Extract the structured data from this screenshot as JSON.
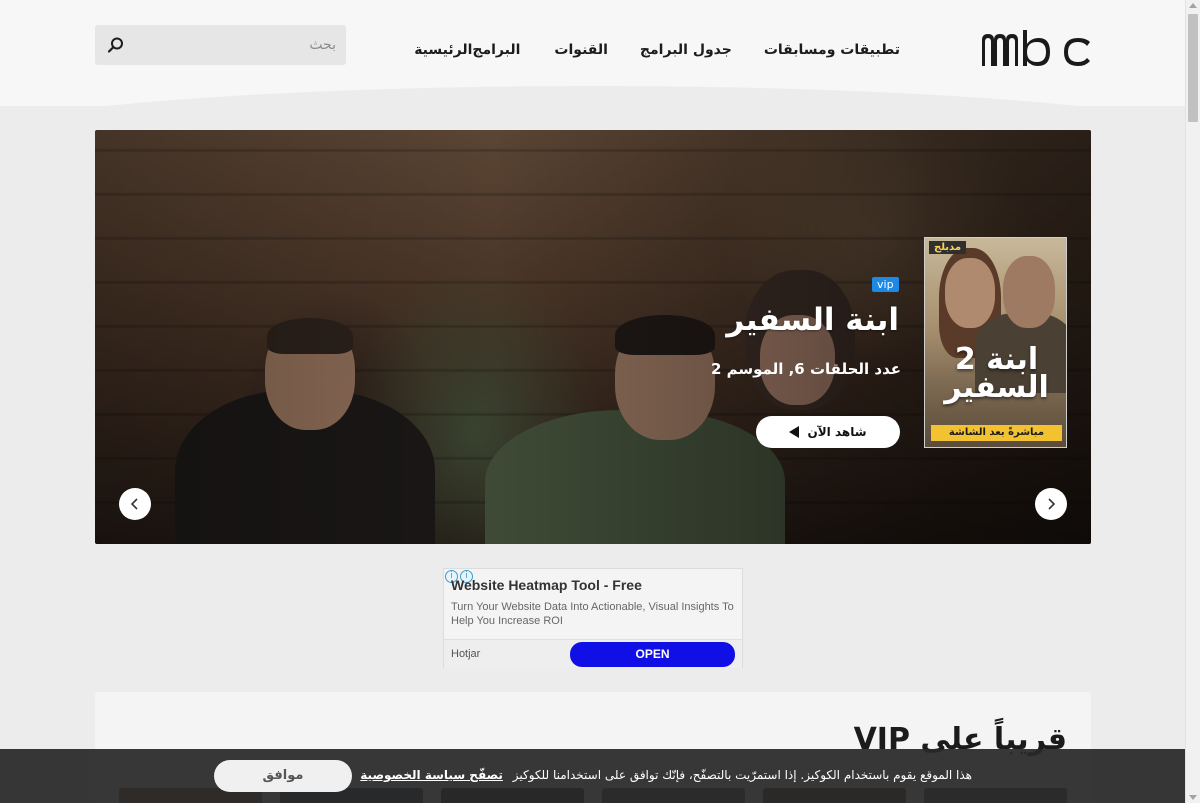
{
  "header": {
    "logo_text": "mbc",
    "nav": [
      {
        "label": "الرئيسية"
      },
      {
        "label": "البرامج"
      },
      {
        "label": "القنوات"
      },
      {
        "label": "جدول البرامج"
      },
      {
        "label": "تطبيقات ومسابقات"
      }
    ],
    "search": {
      "placeholder": "بحث",
      "icon": "search-icon"
    }
  },
  "hero": {
    "badge": "vip",
    "title": "ابنة السفير",
    "subtitle": "عدد الحلقات 6, الموسم 2",
    "watch_label": "شاهد الآن",
    "poster": {
      "badge": "مدبلج",
      "title_line1": "ابنة 2",
      "title_line2": "السفير",
      "strip": "مباشرةً بعد الشاشة"
    },
    "icons": {
      "prev": "chevron-left-icon",
      "next": "chevron-right-icon",
      "play": "play-icon"
    }
  },
  "ad": {
    "title": "Website Heatmap Tool - Free",
    "body": "Turn Your Website Data Into Actionable, Visual Insights To Help You Increase ROI",
    "brand": "Hotjar",
    "cta": "OPEN"
  },
  "section": {
    "title": "قريباً على VIP"
  },
  "cookie": {
    "text": "هذا الموقع يقوم باستخدام الكوكيز. إذا استمرّيت بالتصفّح، فإنّك توافق على استخدامنا للكوكيز",
    "link": "تصفّح سياسة الخصوصية",
    "accept": "موافق"
  },
  "colors": {
    "vip_badge": "#1e88e5",
    "ad_cta": "#1010e6",
    "poster_strip": "#f2c230"
  }
}
